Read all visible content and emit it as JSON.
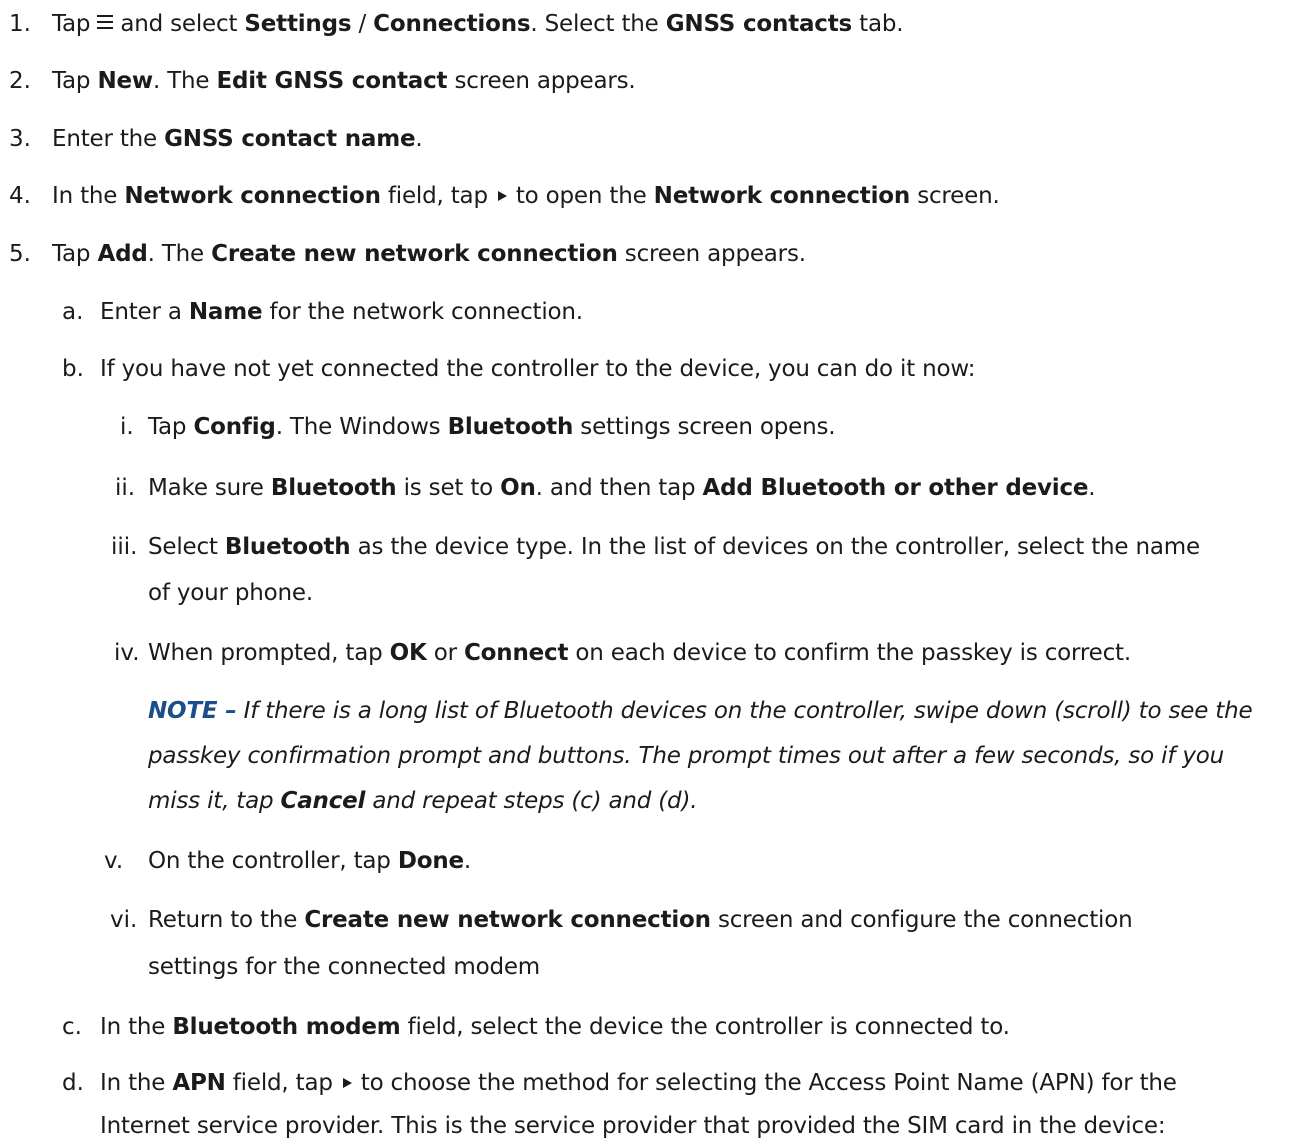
{
  "steps": [
    {
      "marker": "1.",
      "t1": "Tap",
      "t2": "and select",
      "b1": "Settings",
      "t3": "/",
      "b2": "Connections",
      "t4": ". Select the",
      "b3": "GNSS contacts",
      "t5": "tab."
    },
    {
      "marker": "2.",
      "t1": "Tap",
      "b1": "New",
      "t2": ". The",
      "b2": "Edit GNSS contact",
      "t3": "screen appears."
    },
    {
      "marker": "3.",
      "t1": "Enter the",
      "b1": "GNSS contact name",
      "t2": "."
    },
    {
      "marker": "4.",
      "t1": "In the",
      "b1": "Network connection",
      "t2": "field, tap",
      "t3": "to open the",
      "b2": "Network connection",
      "t4": "screen."
    },
    {
      "marker": "5.",
      "t1": "Tap",
      "b1": "Add",
      "t2": ". The",
      "b2": "Create new network connection",
      "t3": "screen appears."
    }
  ],
  "substeps": [
    {
      "marker": "a.",
      "t1": "Enter a",
      "b1": "Name",
      "t2": "for the network connection."
    },
    {
      "marker": "b.",
      "t1": "If you have not yet connected the controller to the device, you can do it now:"
    },
    {
      "marker": "c.",
      "t1": "In the",
      "b1": "Bluetooth modem",
      "t2": "field, select the device the controller is connected to."
    },
    {
      "marker": "d.",
      "t1": "In the",
      "b1": "APN",
      "t2": "field, tap",
      "t3": "to choose the method for selecting the Access Point Name (APN) for the",
      "t4": "Internet service provider. This is the service provider that provided the SIM card in the device:"
    }
  ],
  "roman": [
    {
      "marker": "i.",
      "t1": "Tap",
      "b1": "Config",
      "t2": ". The Windows",
      "b2": "Bluetooth",
      "t3": "settings screen opens."
    },
    {
      "marker": "ii.",
      "t1": "Make sure",
      "b1": "Bluetooth",
      "t2": "is set to",
      "b2": "On",
      "t3": ". and then tap",
      "b3": "Add Bluetooth or other device",
      "t4": "."
    },
    {
      "marker": "iii.",
      "t1": "Select",
      "b1": "Bluetooth",
      "t2": "as the device type. In the list of devices on the controller, select the name",
      "t3": "of your phone."
    },
    {
      "marker": "iv.",
      "t1": "When prompted, tap",
      "b1": "OK",
      "t2": "or",
      "b2": "Connect",
      "t3": "on each device to confirm the passkey is correct."
    },
    {
      "marker": "v.",
      "t1": "On the controller, tap",
      "b1": "Done",
      "t2": "."
    },
    {
      "marker": "vi.",
      "t1": "Return to the",
      "b1": "Create new network connection",
      "t2": "screen and configure the connection",
      "t3": "settings for the connected modem"
    }
  ],
  "note": {
    "label": "NOTE –",
    "line1": "If there is a long list of Bluetooth devices on the controller, swipe down (scroll) to see the",
    "line2": "passkey confirmation prompt and buttons. The prompt times out after a few seconds, so if you",
    "line3a": "miss it, tap",
    "line3b": "Cancel",
    "line3c": "and repeat steps (c) and (d)."
  },
  "icons": {
    "menu": "hamburger-menu-icon",
    "arrow": "play-arrow-icon"
  },
  "colors": {
    "text": "#1b1b1b",
    "note_label": "#1a4f8b"
  }
}
